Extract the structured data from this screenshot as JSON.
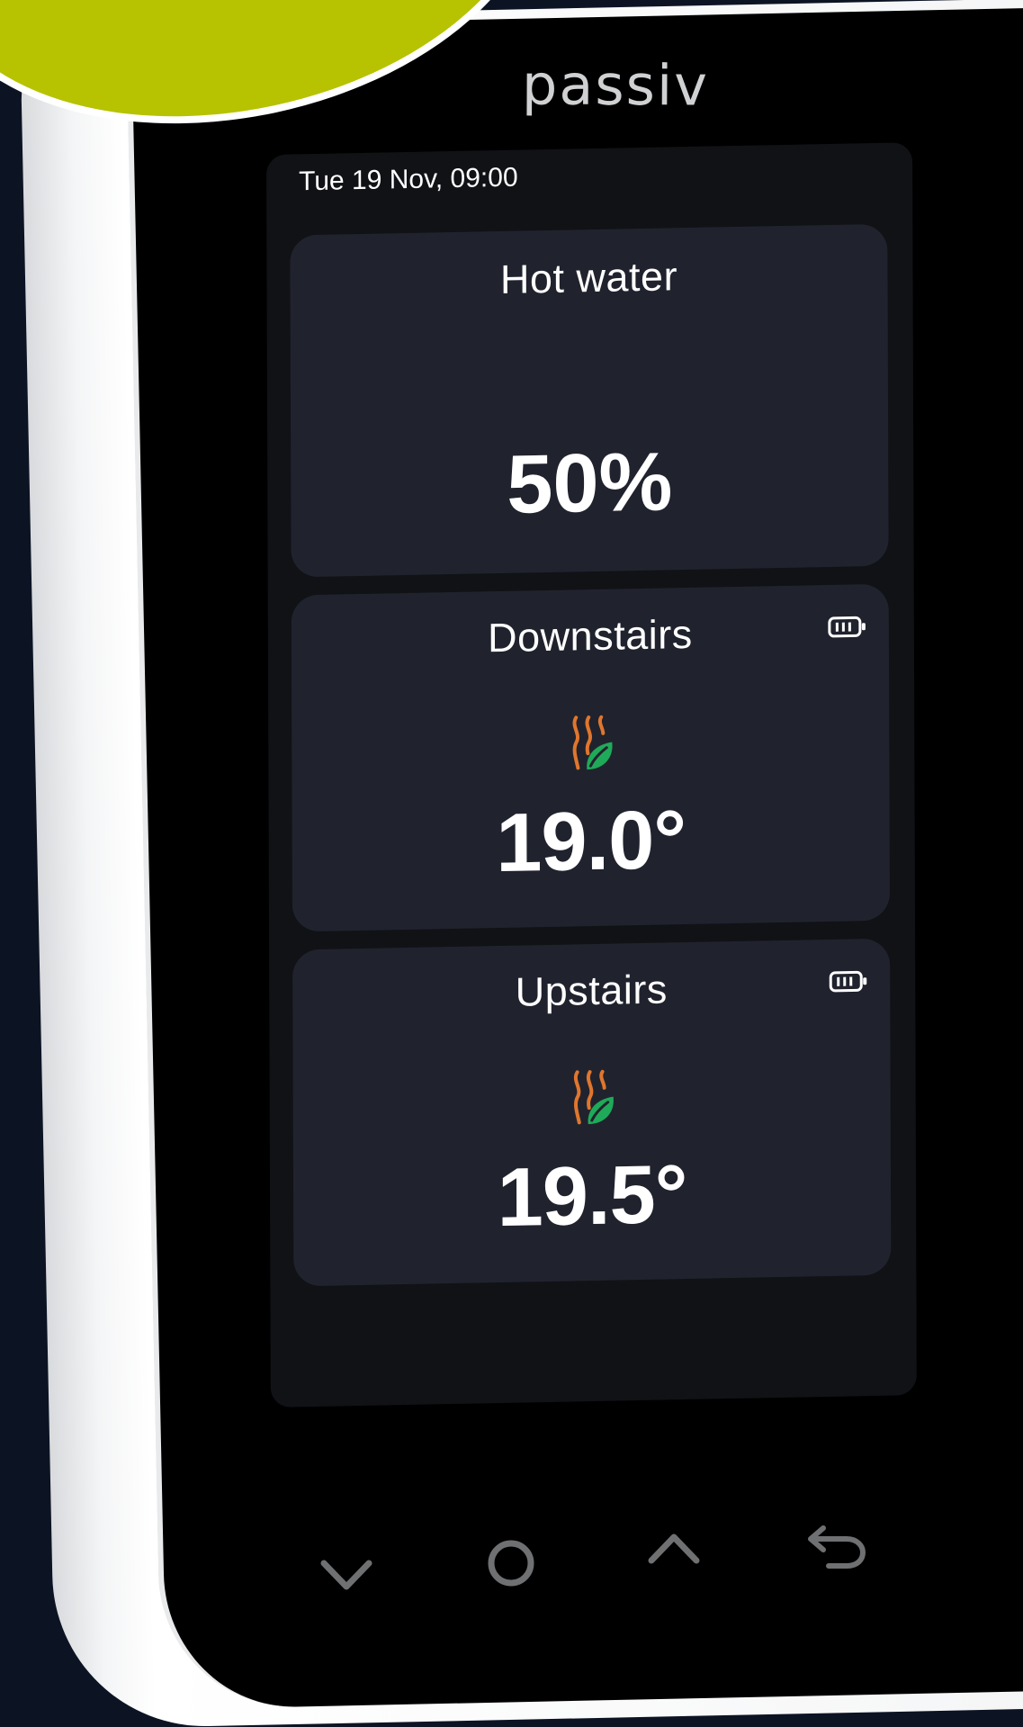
{
  "brand": {
    "logo_text": "passiv",
    "accent_color": "#b7c200"
  },
  "status_bar": {
    "datetime": "Tue 19 Nov, 09:00"
  },
  "cards": {
    "hot_water": {
      "title": "Hot water",
      "value": "50%"
    },
    "downstairs": {
      "title": "Downstairs",
      "value": "19.0°",
      "icon": "heating-eco-icon",
      "battery_icon": "battery-icon"
    },
    "upstairs": {
      "title": "Upstairs",
      "value": "19.5°",
      "icon": "heating-eco-icon",
      "battery_icon": "battery-icon"
    }
  },
  "nav_buttons": [
    {
      "icon": "chevron-down-icon"
    },
    {
      "icon": "circle-home-icon"
    },
    {
      "icon": "chevron-up-icon"
    },
    {
      "icon": "back-arrow-icon"
    }
  ],
  "colors": {
    "card_background": "#20232d",
    "screen_background": "#111216",
    "heat_orange": "#e0762e",
    "leaf_green": "#1faa59",
    "nav_icon": "#6f7072"
  }
}
